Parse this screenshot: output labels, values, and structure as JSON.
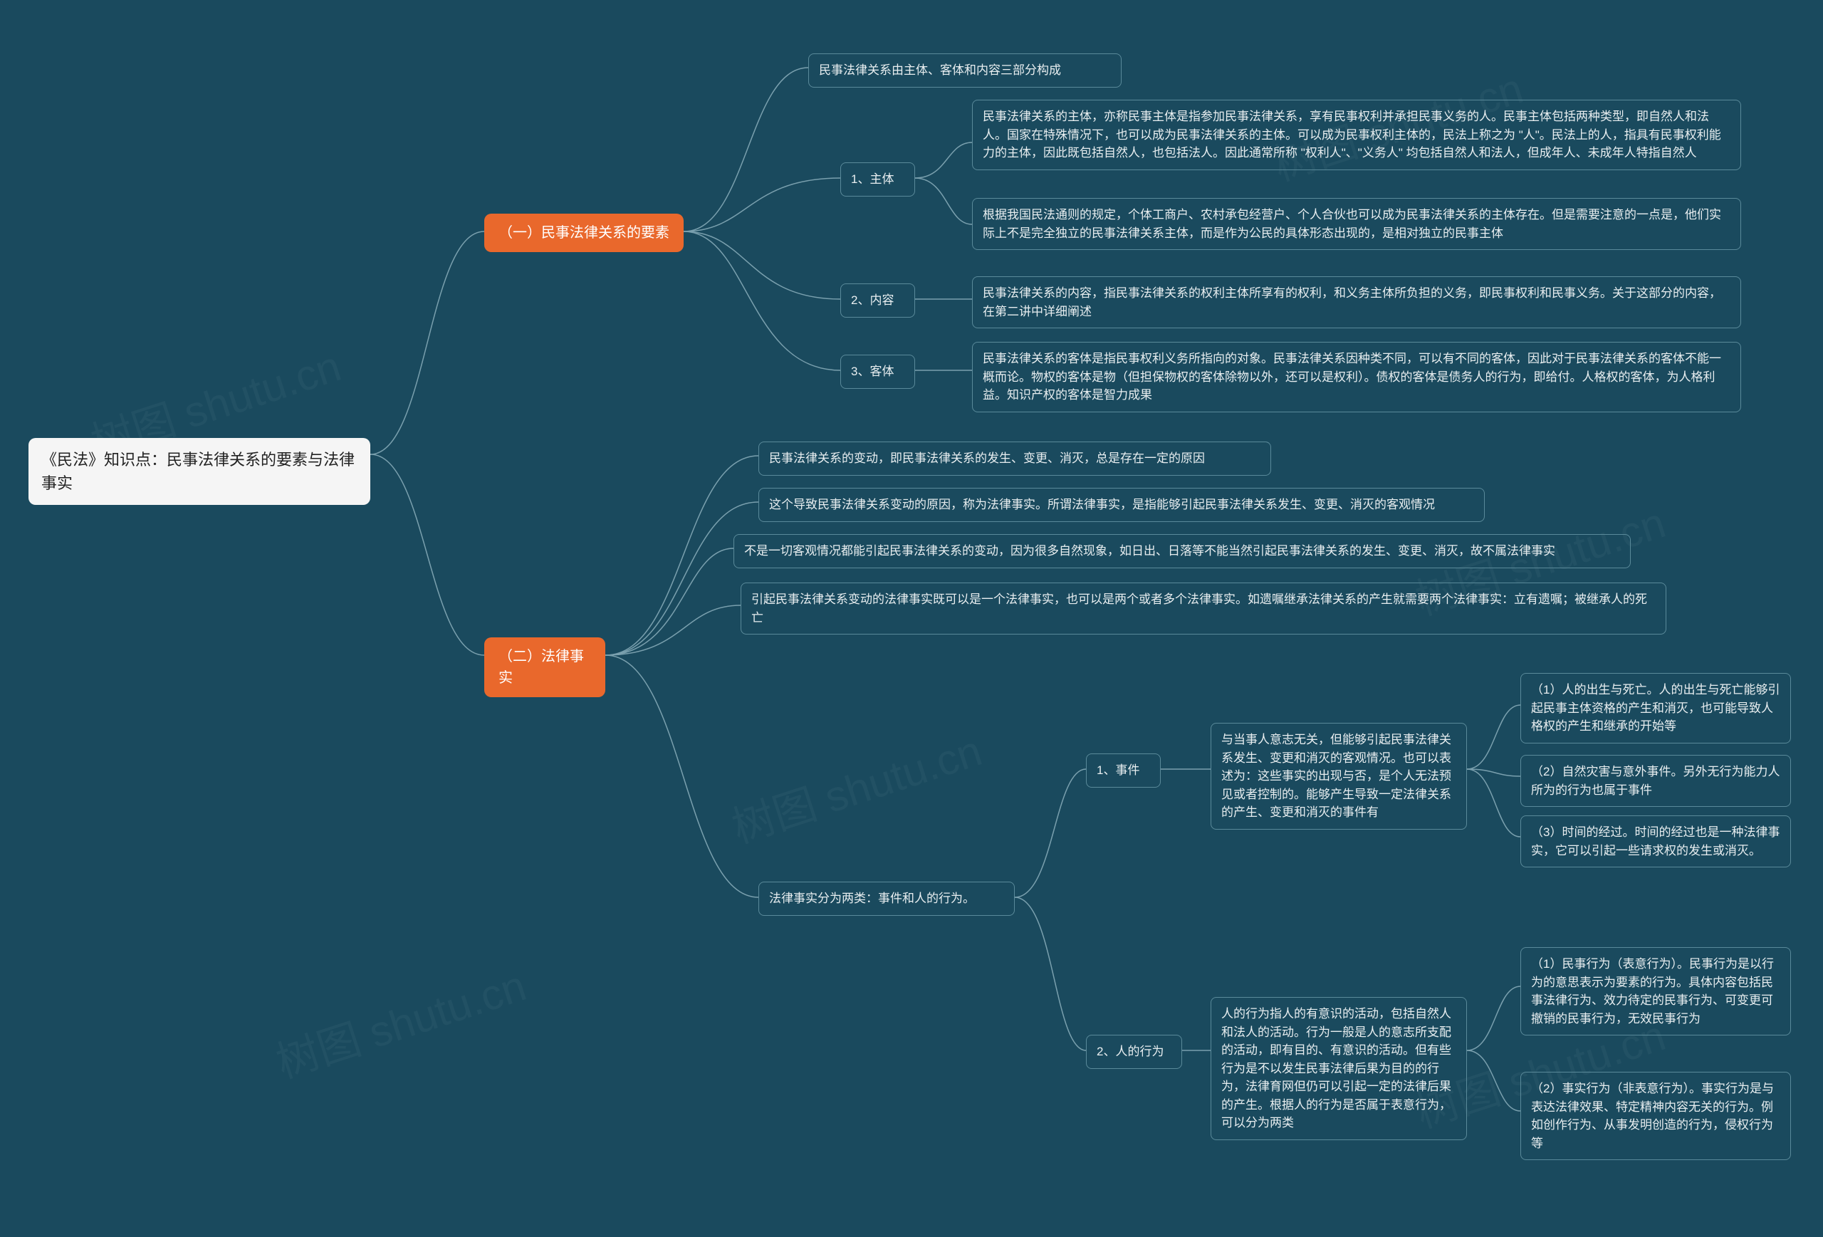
{
  "watermark": "树图 shutu.cn",
  "root": {
    "label": "《民法》知识点：民事法律关系的要素与法律事实"
  },
  "b1": {
    "label": "（一）民事法律关系的要素",
    "l0": "民事法律关系由主体、客体和内容三部分构成",
    "sub1": {
      "label": "1、主体",
      "l1": "民事法律关系的主体，亦称民事主体是指参加民事法律关系，享有民事权利并承担民事义务的人。民事主体包括两种类型，即自然人和法人。国家在特殊情况下，也可以成为民事法律关系的主体。可以成为民事权利主体的，民法上称之为 \"人\"。民法上的人，指具有民事权利能力的主体，因此既包括自然人，也包括法人。因此通常所称 \"权利人\"、\"义务人\" 均包括自然人和法人，但成年人、未成年人特指自然人",
      "l2": "根据我国民法通则的规定，个体工商户、农村承包经营户、个人合伙也可以成为民事法律关系的主体存在。但是需要注意的一点是，他们实际上不是完全独立的民事法律关系主体，而是作为公民的具体形态出现的，是相对独立的民事主体"
    },
    "sub2": {
      "label": "2、内容",
      "l1": "民事法律关系的内容，指民事法律关系的权利主体所享有的权利，和义务主体所负担的义务，即民事权利和民事义务。关于这部分的内容，在第二讲中详细阐述"
    },
    "sub3": {
      "label": "3、客体",
      "l1": "民事法律关系的客体是指民事权利义务所指向的对象。民事法律关系因种类不同，可以有不同的客体，因此对于民事法律关系的客体不能一概而论。物权的客体是物（但担保物权的客体除物以外，还可以是权利）。债权的客体是债务人的行为，即给付。人格权的客体，为人格利益。知识产权的客体是智力成果"
    }
  },
  "b2": {
    "label": "（二）法律事实",
    "l1": "民事法律关系的变动，即民事法律关系的发生、变更、消灭，总是存在一定的原因",
    "l2": "这个导致民事法律关系变动的原因，称为法律事实。所谓法律事实，是指能够引起民事法律关系发生、变更、消灭的客观情况",
    "l3": "不是一切客观情况都能引起民事法律关系的变动，因为很多自然现象，如日出、日落等不能当然引起民事法律关系的发生、变更、消灭，故不属法律事实",
    "l4": "引起民事法律关系变动的法律事实既可以是一个法律事实，也可以是两个或者多个法律事实。如遗嘱继承法律关系的产生就需要两个法律事实：立有遗嘱；被继承人的死亡",
    "sub5": {
      "label": "法律事实分为两类：事件和人的行为。",
      "e": {
        "label": "1、事件",
        "desc": "与当事人意志无关，但能够引起民事法律关系发生、变更和消灭的客观情况。也可以表述为：这些事实的出现与否，是个人无法预见或者控制的。能够产生导致一定法律关系的产生、变更和消灭的事件有",
        "i1": "（1）人的出生与死亡。人的出生与死亡能够引起民事主体资格的产生和消灭，也可能导致人格权的产生和继承的开始等",
        "i2": "（2）自然灾害与意外事件。另外无行为能力人所为的行为也属于事件",
        "i3": "（3）时间的经过。时间的经过也是一种法律事实，它可以引起一些请求权的发生或消灭。"
      },
      "a": {
        "label": "2、人的行为",
        "desc": "人的行为指人的有意识的活动，包括自然人和法人的活动。行为一般是人的意志所支配的活动，即有目的、有意识的活动。但有些行为是不以发生民事法律后果为目的的行为，法律育网但仍可以引起一定的法律后果的产生。根据人的行为是否属于表意行为，可以分为两类",
        "i1": "（1）民事行为（表意行为）。民事行为是以行为的意思表示为要素的行为。具体内容包括民事法律行为、效力待定的民事行为、可变更可撤销的民事行为，无效民事行为",
        "i2": "（2）事实行为（非表意行为）。事实行为是与表达法律效果、特定精神内容无关的行为。例如创作行为、从事发明创造的行为，侵权行为等"
      }
    }
  },
  "chart_data": {
    "type": "mindmap",
    "root": "《民法》知识点：民事法律关系的要素与法律事实",
    "children": [
      {
        "label": "（一）民事法律关系的要素",
        "children": [
          {
            "label": "民事法律关系由主体、客体和内容三部分构成"
          },
          {
            "label": "1、主体",
            "children": [
              "民事法律关系的主体，亦称民事主体是指参加民事法律关系，享有民事权利并承担民事义务的人。民事主体包括两种类型，即自然人和法人。国家在特殊情况下，也可以成为民事法律关系的主体。可以成为民事权利主体的，民法上称之为 \"人\"。民法上的人，指具有民事权利能力的主体，因此既包括自然人，也包括法人。因此通常所称 \"权利人\"、\"义务人\" 均包括自然人和法人，但成年人、未成年人特指自然人",
              "根据我国民法通则的规定，个体工商户、农村承包经营户、个人合伙也可以成为民事法律关系的主体存在。但是需要注意的一点是，他们实际上不是完全独立的民事法律关系主体，而是作为公民的具体形态出现的，是相对独立的民事主体"
            ]
          },
          {
            "label": "2、内容",
            "children": [
              "民事法律关系的内容，指民事法律关系的权利主体所享有的权利，和义务主体所负担的义务，即民事权利和民事义务。关于这部分的内容，在第二讲中详细阐述"
            ]
          },
          {
            "label": "3、客体",
            "children": [
              "民事法律关系的客体是指民事权利义务所指向的对象。民事法律关系因种类不同，可以有不同的客体，因此对于民事法律关系的客体不能一概而论。物权的客体是物（但担保物权的客体除物以外，还可以是权利）。债权的客体是债务人的行为，即给付。人格权的客体，为人格利益。知识产权的客体是智力成果"
            ]
          }
        ]
      },
      {
        "label": "（二）法律事实",
        "children": [
          "民事法律关系的变动，即民事法律关系的发生、变更、消灭，总是存在一定的原因",
          "这个导致民事法律关系变动的原因，称为法律事实。所谓法律事实，是指能够引起民事法律关系发生、变更、消灭的客观情况",
          "不是一切客观情况都能引起民事法律关系的变动，因为很多自然现象，如日出、日落等不能当然引起民事法律关系的发生、变更、消灭，故不属法律事实",
          "引起民事法律关系变动的法律事实既可以是一个法律事实，也可以是两个或者多个法律事实。如遗嘱继承法律关系的产生就需要两个法律事实：立有遗嘱；被继承人的死亡",
          {
            "label": "法律事实分为两类：事件和人的行为。",
            "children": [
              {
                "label": "1、事件",
                "desc": "与当事人意志无关，但能够引起民事法律关系发生、变更和消灭的客观情况。也可以表述为：这些事实的出现与否，是个人无法预见或者控制的。能够产生导致一定法律关系的产生、变更和消灭的事件有",
                "children": [
                  "（1）人的出生与死亡。人的出生与死亡能够引起民事主体资格的产生和消灭，也可能导致人格权的产生和继承的开始等",
                  "（2）自然灾害与意外事件。另外无行为能力人所为的行为也属于事件",
                  "（3）时间的经过。时间的经过也是一种法律事实，它可以引起一些请求权的发生或消灭。"
                ]
              },
              {
                "label": "2、人的行为",
                "desc": "人的行为指人的有意识的活动，包括自然人和法人的活动。行为一般是人的意志所支配的活动，即有目的、有意识的活动。但有些行为是不以发生民事法律后果为目的的行为，法律育网但仍可以引起一定的法律后果的产生。根据人的行为是否属于表意行为，可以分为两类",
                "children": [
                  "（1）民事行为（表意行为）。民事行为是以行为的意思表示为要素的行为。具体内容包括民事法律行为、效力待定的民事行为、可变更可撤销的民事行为，无效民事行为",
                  "（2）事实行为（非表意行为）。事实行为是与表达法律效果、特定精神内容无关的行为。例如创作行为、从事发明创造的行为，侵权行为等"
                ]
              }
            ]
          }
        ]
      }
    ]
  }
}
